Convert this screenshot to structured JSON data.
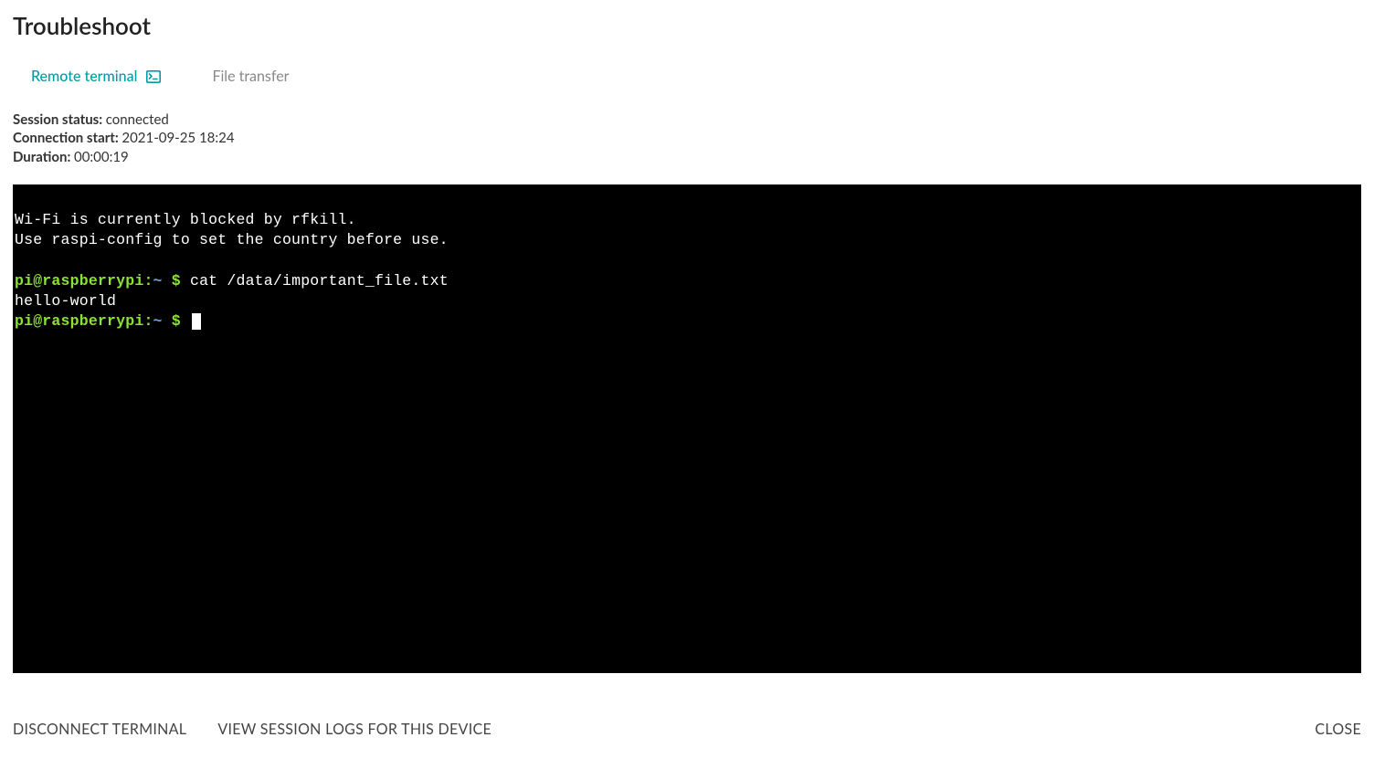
{
  "title": "Troubleshoot",
  "tabs": {
    "remote_terminal": "Remote terminal",
    "file_transfer": "File transfer"
  },
  "session": {
    "status_label": "Session status:",
    "status_value": "connected",
    "conn_start_label": "Connection start:",
    "conn_start_value": "2021-09-25 18:24",
    "duration_label": "Duration:",
    "duration_value": "00:00:19"
  },
  "terminal": {
    "line1": "Wi-Fi is currently blocked by rfkill.",
    "line2": "Use raspi-config to set the country before use.",
    "prompt_user": "pi@raspberrypi",
    "prompt_colon": ":",
    "prompt_path": "~",
    "prompt_dollar": " $ ",
    "cmd1": "cat /data/important_file.txt",
    "out1": "hello-world"
  },
  "footer": {
    "disconnect": "DISCONNECT TERMINAL",
    "view_logs": "VIEW SESSION LOGS FOR THIS DEVICE",
    "close": "CLOSE"
  }
}
